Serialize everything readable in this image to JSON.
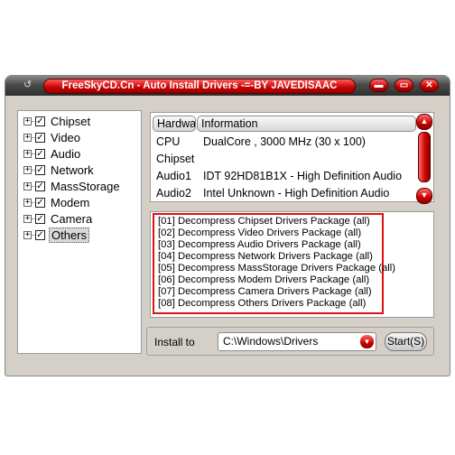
{
  "window": {
    "title": "FreeSkyCD.Cn - Auto Install Drivers -=-BY JAVEDISAAC",
    "minimize_glyph": "▬",
    "restore_glyph": "▭",
    "close_glyph": "✕",
    "app_icon": "↺"
  },
  "tree": {
    "items": [
      {
        "label": "Chipset",
        "checked": true
      },
      {
        "label": "Video",
        "checked": true
      },
      {
        "label": "Audio",
        "checked": true
      },
      {
        "label": "Network",
        "checked": true
      },
      {
        "label": "MassStorage",
        "checked": true
      },
      {
        "label": "Modem",
        "checked": true
      },
      {
        "label": "Camera",
        "checked": true
      },
      {
        "label": "Others",
        "checked": true,
        "selected": true
      }
    ],
    "expander_glyph": "+",
    "check_glyph": "✓"
  },
  "info": {
    "columns": [
      "Hardwa",
      "Information"
    ],
    "rows": [
      {
        "hardware": "CPU",
        "information": "DualCore , 3000 MHz (30 x 100)"
      },
      {
        "hardware": "Chipset",
        "information": ""
      },
      {
        "hardware": "Audio1",
        "information": "IDT 92HD81B1X  - High Definition Audio"
      },
      {
        "hardware": "Audio2",
        "information": "Intel Unknown  - High Definition Audio"
      }
    ],
    "scroll_up": "▲",
    "scroll_down": "▼"
  },
  "log": {
    "lines": [
      "[01] Decompress Chipset Drivers Package (all)",
      "[02] Decompress Video Drivers Package (all)",
      "[03] Decompress Audio Drivers Package (all)",
      "[04] Decompress Network Drivers Package (all)",
      "[05] Decompress MassStorage Drivers Package (all)",
      "[06] Decompress Modem Drivers Package (all)",
      "[07] Decompress Camera Drivers Package (all)",
      "[08] Decompress Others Drivers Package (all)"
    ]
  },
  "install": {
    "label": "Install to",
    "path": "C:\\Windows\\Drivers",
    "dropdown_glyph": "▼",
    "start_label": "Start(S)"
  },
  "colors": {
    "accent": "#c80000",
    "highlight_frame": "#e01010"
  }
}
